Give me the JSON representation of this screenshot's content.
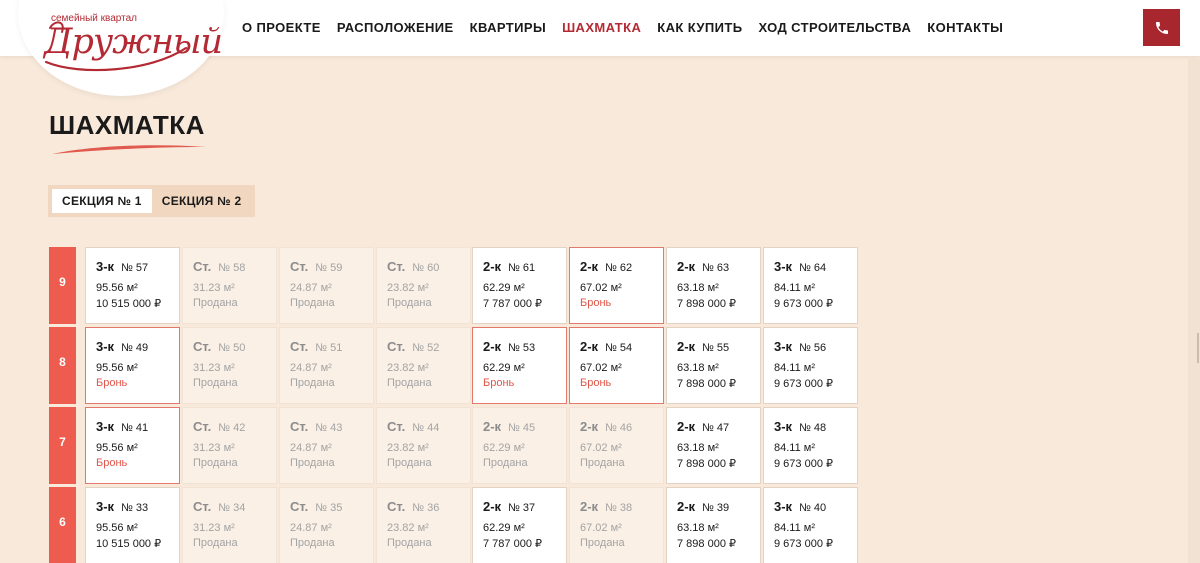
{
  "logo": {
    "subtitle": "семейный квартал",
    "name": "Дружный"
  },
  "nav": {
    "items": [
      {
        "label": "О ПРОЕКТЕ",
        "active": false
      },
      {
        "label": "РАСПОЛОЖЕНИЕ",
        "active": false
      },
      {
        "label": "КВАРТИРЫ",
        "active": false
      },
      {
        "label": "ШАХМАТКА",
        "active": true
      },
      {
        "label": "КАК КУПИТЬ",
        "active": false
      },
      {
        "label": "ХОД СТРОИТЕЛЬСТВА",
        "active": false
      },
      {
        "label": "КОНТАКТЫ",
        "active": false
      }
    ],
    "phone_icon": "phone-icon"
  },
  "page": {
    "title": "ШАХМАТКА"
  },
  "sections": [
    {
      "label": "СЕКЦИЯ № 1",
      "active": true
    },
    {
      "label": "СЕКЦИЯ № 2",
      "active": false
    }
  ],
  "floors": [
    {
      "floor": "9",
      "apartments": [
        {
          "type": "3-к",
          "number": "№ 57",
          "area": "95.56 м²",
          "price": "10 515 000 ₽",
          "status": "free"
        },
        {
          "type": "Ст.",
          "number": "№ 58",
          "area": "31.23 м²",
          "price": "Продана",
          "status": "sold"
        },
        {
          "type": "Ст.",
          "number": "№ 59",
          "area": "24.87 м²",
          "price": "Продана",
          "status": "sold"
        },
        {
          "type": "Ст.",
          "number": "№ 60",
          "area": "23.82 м²",
          "price": "Продана",
          "status": "sold"
        },
        {
          "type": "2-к",
          "number": "№ 61",
          "area": "62.29 м²",
          "price": "7 787 000 ₽",
          "status": "free"
        },
        {
          "type": "2-к",
          "number": "№ 62",
          "area": "67.02 м²",
          "price": "Бронь",
          "status": "reserved"
        },
        {
          "type": "2-к",
          "number": "№ 63",
          "area": "63.18 м²",
          "price": "7 898 000 ₽",
          "status": "free"
        },
        {
          "type": "3-к",
          "number": "№ 64",
          "area": "84.11 м²",
          "price": "9 673 000 ₽",
          "status": "free"
        }
      ]
    },
    {
      "floor": "8",
      "apartments": [
        {
          "type": "3-к",
          "number": "№ 49",
          "area": "95.56 м²",
          "price": "Бронь",
          "status": "reserved"
        },
        {
          "type": "Ст.",
          "number": "№ 50",
          "area": "31.23 м²",
          "price": "Продана",
          "status": "sold"
        },
        {
          "type": "Ст.",
          "number": "№ 51",
          "area": "24.87 м²",
          "price": "Продана",
          "status": "sold"
        },
        {
          "type": "Ст.",
          "number": "№ 52",
          "area": "23.82 м²",
          "price": "Продана",
          "status": "sold"
        },
        {
          "type": "2-к",
          "number": "№ 53",
          "area": "62.29 м²",
          "price": "Бронь",
          "status": "reserved"
        },
        {
          "type": "2-к",
          "number": "№ 54",
          "area": "67.02 м²",
          "price": "Бронь",
          "status": "reserved"
        },
        {
          "type": "2-к",
          "number": "№ 55",
          "area": "63.18 м²",
          "price": "7 898 000 ₽",
          "status": "free"
        },
        {
          "type": "3-к",
          "number": "№ 56",
          "area": "84.11 м²",
          "price": "9 673 000 ₽",
          "status": "free"
        }
      ]
    },
    {
      "floor": "7",
      "apartments": [
        {
          "type": "3-к",
          "number": "№ 41",
          "area": "95.56 м²",
          "price": "Бронь",
          "status": "reserved"
        },
        {
          "type": "Ст.",
          "number": "№ 42",
          "area": "31.23 м²",
          "price": "Продана",
          "status": "sold"
        },
        {
          "type": "Ст.",
          "number": "№ 43",
          "area": "24.87 м²",
          "price": "Продана",
          "status": "sold"
        },
        {
          "type": "Ст.",
          "number": "№ 44",
          "area": "23.82 м²",
          "price": "Продана",
          "status": "sold"
        },
        {
          "type": "2-к",
          "number": "№ 45",
          "area": "62.29 м²",
          "price": "Продана",
          "status": "sold"
        },
        {
          "type": "2-к",
          "number": "№ 46",
          "area": "67.02 м²",
          "price": "Продана",
          "status": "sold"
        },
        {
          "type": "2-к",
          "number": "№ 47",
          "area": "63.18 м²",
          "price": "7 898 000 ₽",
          "status": "free"
        },
        {
          "type": "3-к",
          "number": "№ 48",
          "area": "84.11 м²",
          "price": "9 673 000 ₽",
          "status": "free"
        }
      ]
    },
    {
      "floor": "6",
      "apartments": [
        {
          "type": "3-к",
          "number": "№ 33",
          "area": "95.56 м²",
          "price": "10 515 000 ₽",
          "status": "free"
        },
        {
          "type": "Ст.",
          "number": "№ 34",
          "area": "31.23 м²",
          "price": "Продана",
          "status": "sold"
        },
        {
          "type": "Ст.",
          "number": "№ 35",
          "area": "24.87 м²",
          "price": "Продана",
          "status": "sold"
        },
        {
          "type": "Ст.",
          "number": "№ 36",
          "area": "23.82 м²",
          "price": "Продана",
          "status": "sold"
        },
        {
          "type": "2-к",
          "number": "№ 37",
          "area": "62.29 м²",
          "price": "7 787 000 ₽",
          "status": "free"
        },
        {
          "type": "2-к",
          "number": "№ 38",
          "area": "67.02 м²",
          "price": "Продана",
          "status": "sold"
        },
        {
          "type": "2-к",
          "number": "№ 39",
          "area": "63.18 м²",
          "price": "7 898 000 ₽",
          "status": "free"
        },
        {
          "type": "3-к",
          "number": "№ 40",
          "area": "84.11 м²",
          "price": "9 673 000 ₽",
          "status": "free"
        }
      ]
    }
  ],
  "colors": {
    "accent": "#b42a34",
    "floor_badge": "#ee5b4f",
    "reserved": "#e0574a",
    "background": "#f8e9da"
  }
}
